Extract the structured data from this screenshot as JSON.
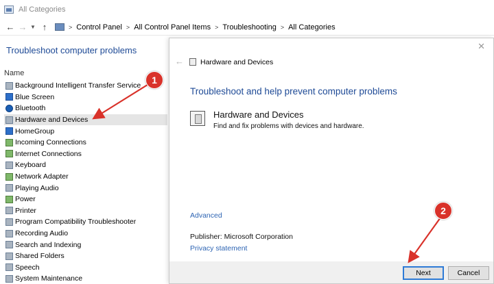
{
  "window": {
    "title": "All Categories"
  },
  "address_bar": {
    "breadcrumbs": [
      "Control Panel",
      "All Control Panel Items",
      "Troubleshooting",
      "All Categories"
    ]
  },
  "left_panel": {
    "title": "Troubleshoot computer problems",
    "column_header": "Name",
    "items": [
      {
        "label": "Background Intelligent Transfer Service",
        "icon": "bits-icon"
      },
      {
        "label": "Blue Screen",
        "icon": "blue-screen-icon"
      },
      {
        "label": "Bluetooth",
        "icon": "bluetooth-icon"
      },
      {
        "label": "Hardware and Devices",
        "icon": "hardware-icon",
        "selected": true
      },
      {
        "label": "HomeGroup",
        "icon": "homegroup-icon"
      },
      {
        "label": "Incoming Connections",
        "icon": "incoming-connections-icon"
      },
      {
        "label": "Internet Connections",
        "icon": "internet-connections-icon"
      },
      {
        "label": "Keyboard",
        "icon": "keyboard-icon"
      },
      {
        "label": "Network Adapter",
        "icon": "network-adapter-icon"
      },
      {
        "label": "Playing Audio",
        "icon": "playing-audio-icon"
      },
      {
        "label": "Power",
        "icon": "power-icon"
      },
      {
        "label": "Printer",
        "icon": "printer-icon"
      },
      {
        "label": "Program Compatibility Troubleshooter",
        "icon": "program-compat-icon"
      },
      {
        "label": "Recording Audio",
        "icon": "recording-audio-icon"
      },
      {
        "label": "Search and Indexing",
        "icon": "search-indexing-icon"
      },
      {
        "label": "Shared Folders",
        "icon": "shared-folders-icon"
      },
      {
        "label": "Speech",
        "icon": "speech-icon"
      },
      {
        "label": "System Maintenance",
        "icon": "system-maintenance-icon"
      }
    ]
  },
  "dialog": {
    "header_title": "Hardware and Devices",
    "heading": "Troubleshoot and help prevent computer problems",
    "troubleshooter_title": "Hardware and Devices",
    "troubleshooter_desc": "Find and fix problems with devices and hardware.",
    "advanced_link": "Advanced",
    "publisher": "Publisher:  Microsoft Corporation",
    "privacy_link": "Privacy statement",
    "next_label": "Next",
    "cancel_label": "Cancel"
  },
  "annotations": {
    "badge_1": "1",
    "badge_2": "2",
    "color": "#d9322a"
  },
  "colors": {
    "heading_blue": "#1e4a96",
    "link_blue": "#2d64b3",
    "selected_row": "#e5e5e5",
    "footer_gray": "#f0f0f0"
  }
}
